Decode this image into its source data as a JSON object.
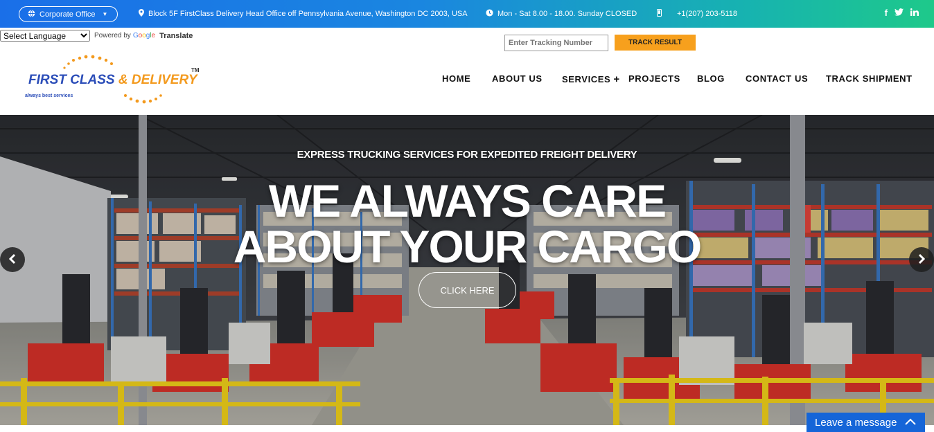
{
  "topbar": {
    "office": "Corporate Office",
    "address": "Block 5F FirstClass Delivery Head Office off Pennsylvania Avenue, Washington DC 2003, USA",
    "hours": "Mon - Sat 8.00 - 18.00. Sunday CLOSED",
    "phone": "+1(207) 203-5118",
    "social": [
      "facebook-icon",
      "twitter-icon",
      "linkedin-icon"
    ]
  },
  "translate": {
    "select_value": "Select Language",
    "powered_by": "Powered by",
    "google": "Google",
    "translate": "Translate"
  },
  "tracking": {
    "placeholder": "Enter Tracking Number",
    "button": "TRACK RESULT"
  },
  "logo": {
    "name_a": "FIRST CLASS",
    "amp": "& DELIVERY",
    "tm": "TM",
    "tagline": "always best services"
  },
  "nav": {
    "items": [
      "HOME",
      "ABOUT US",
      "SERVICES",
      "PROJECTS",
      "BLOG",
      "CONTACT US",
      "TRACK SHIPMENT"
    ],
    "services_plus": "+"
  },
  "hero": {
    "subtitle": "EXPRESS TRUCKING SERVICES FOR EXPEDITED FREIGHT DELIVERY",
    "title_line1": "WE ALWAYS CARE",
    "title_line2": "ABOUT YOUR CARGO",
    "button": "CLICK HERE"
  },
  "chat": {
    "label": "Leave a message"
  },
  "colors": {
    "accent_orange": "#f7a01d",
    "brand_blue": "#2b4db8",
    "chat_blue": "#1565d8"
  }
}
